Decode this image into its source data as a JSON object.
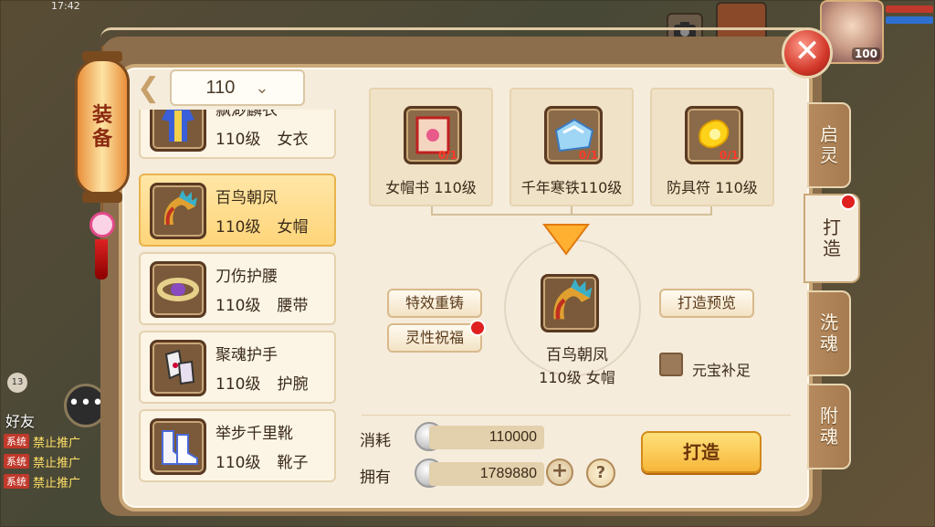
{
  "status": {
    "time": "17:42"
  },
  "chat": {
    "title": "好友",
    "badge": "13",
    "rows": [
      {
        "tag": "系统",
        "text": "禁止推广"
      },
      {
        "tag": "系统",
        "text": "禁止推广"
      },
      {
        "tag": "系统",
        "text": "禁止推广"
      }
    ]
  },
  "player": {
    "level": "100"
  },
  "panel": {
    "category_title": [
      "装",
      "备"
    ],
    "level_value": "110"
  },
  "equipment_list": [
    {
      "name": "飘渺麟衣",
      "level": "110级",
      "type": "女衣",
      "icon": "robe-icon"
    },
    {
      "name": "百鸟朝凤",
      "level": "110级",
      "type": "女帽",
      "icon": "phoenix-hat-icon",
      "selected": true
    },
    {
      "name": "刀伤护腰",
      "level": "110级",
      "type": "腰带",
      "icon": "belt-icon"
    },
    {
      "name": "聚魂护手",
      "level": "110级",
      "type": "护腕",
      "icon": "bracer-icon"
    },
    {
      "name": "举步千里靴",
      "level": "110级",
      "type": "靴子",
      "icon": "boots-icon"
    }
  ],
  "materials": [
    {
      "label": "女帽书  110级",
      "count": "0/1",
      "icon": "scroll-icon"
    },
    {
      "label": "千年寒铁110级",
      "count": "0/1",
      "icon": "iron-icon"
    },
    {
      "label": "防具符  110级",
      "count": "0/1",
      "icon": "talisman-icon"
    }
  ],
  "target": {
    "name": "百鸟朝凤",
    "sub": "110级 女帽"
  },
  "buttons": {
    "effect_reforge": "特效重铸",
    "spirit_bless": "灵性祝福",
    "forge_preview": "打造预览",
    "forge": "打造",
    "help": "?",
    "plus": "+"
  },
  "auto_fill": {
    "label": "元宝补足",
    "checked": false
  },
  "cost": {
    "consume_label": "消耗",
    "consume_value": "110000",
    "have_label": "拥有",
    "have_value": "1789880"
  },
  "side_tabs": [
    {
      "label": [
        "启",
        "灵"
      ]
    },
    {
      "label": [
        "打",
        "造"
      ],
      "active": true
    },
    {
      "label": [
        "洗",
        "魂"
      ]
    },
    {
      "label": [
        "附",
        "魂"
      ]
    }
  ],
  "colors": {
    "accent": "#f6b73a",
    "panel_bg": "#f5ecdc",
    "notify": "#e02020"
  }
}
